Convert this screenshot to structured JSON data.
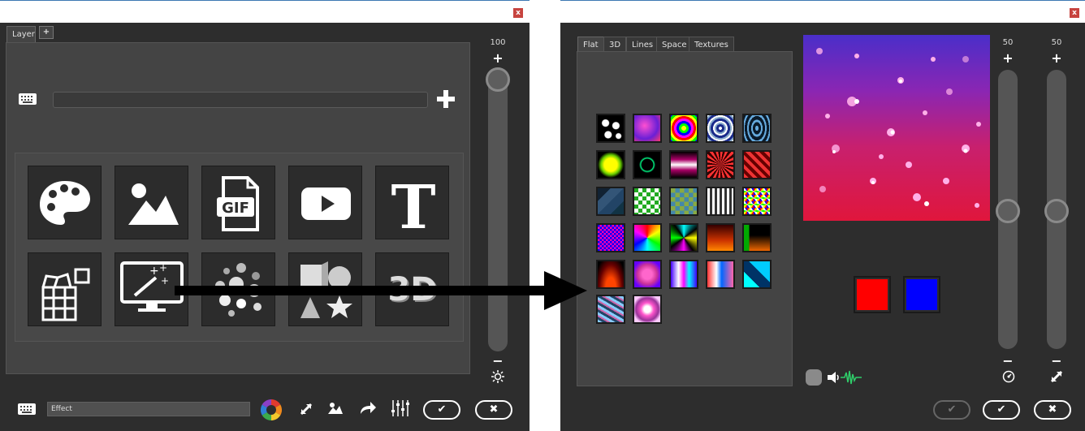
{
  "left_window": {
    "close_label": "x",
    "tabs": [
      {
        "label": "Layer"
      },
      {
        "label": "+"
      }
    ],
    "slider": {
      "value": "100",
      "level": 1.0,
      "plus": "+",
      "minus": "−"
    },
    "brightness_icon": "sun-icon",
    "input_placeholder": "",
    "source_tiles": [
      "palette-icon",
      "image-icon",
      "gif-icon",
      "video-play-icon",
      "text-icon",
      "grid-blocks-icon",
      "magic-wand-screen-icon",
      "particles-icon",
      "3d-shapes-icon",
      "3d-text-icon"
    ],
    "gif_text": "GIF",
    "text_icon_glyph": "T",
    "threed_text": "3D",
    "bottom": {
      "effect_label": "Effect",
      "ok": "✔",
      "cancel": "✖"
    }
  },
  "right_window": {
    "close_label": "x",
    "tabs": [
      {
        "label": "Flat"
      },
      {
        "label": "3D"
      },
      {
        "label": "Lines"
      },
      {
        "label": "Space"
      },
      {
        "label": "Textures"
      }
    ],
    "active_tab": "Flat",
    "colors": {
      "primary": "#ff0000",
      "secondary": "#0000ff"
    },
    "speed_slider": {
      "value": "50",
      "level": 0.5,
      "plus": "+",
      "minus": "−",
      "icon": "speedometer-icon"
    },
    "size_slider": {
      "value": "50",
      "level": 0.5,
      "plus": "+",
      "minus": "−",
      "icon": "resize-icon"
    },
    "bottom": {
      "disabled_ok": "✔",
      "ok": "✔",
      "cancel": "✖"
    }
  },
  "arrow": "right-arrow"
}
